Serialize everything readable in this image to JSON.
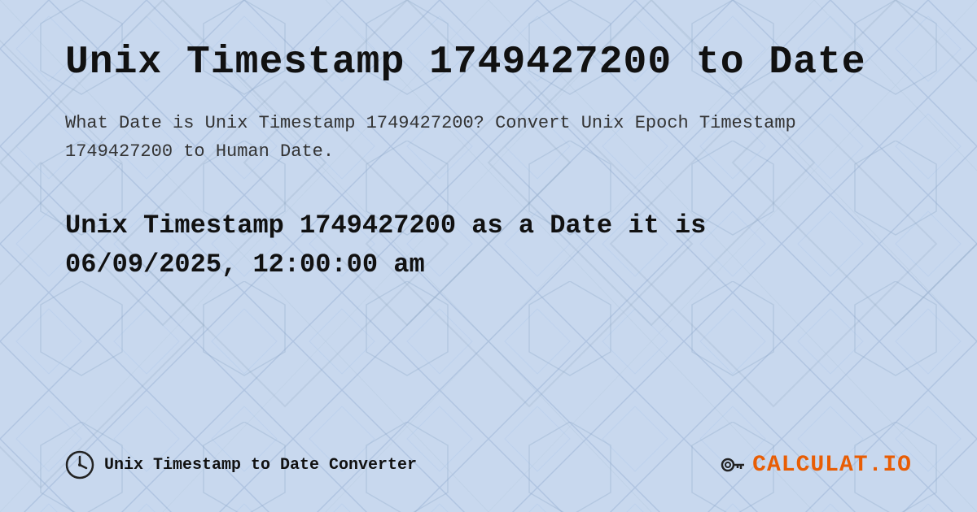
{
  "page": {
    "title": "Unix Timestamp 1749427200 to Date",
    "description": "What Date is Unix Timestamp 1749427200? Convert Unix Epoch Timestamp 1749427200 to Human Date.",
    "result_line1": "Unix Timestamp 1749427200 as a Date it is",
    "result_line2": "06/09/2025, 12:00:00 am",
    "background_color": "#c8d8f0"
  },
  "footer": {
    "label": "Unix Timestamp to Date Converter",
    "logo_text_main": "CALCULAT",
    "logo_text_accent": ".IO"
  },
  "colors": {
    "background": "#c8d8ee",
    "text_primary": "#111111",
    "text_body": "#333333",
    "accent_orange": "#e85d04"
  }
}
